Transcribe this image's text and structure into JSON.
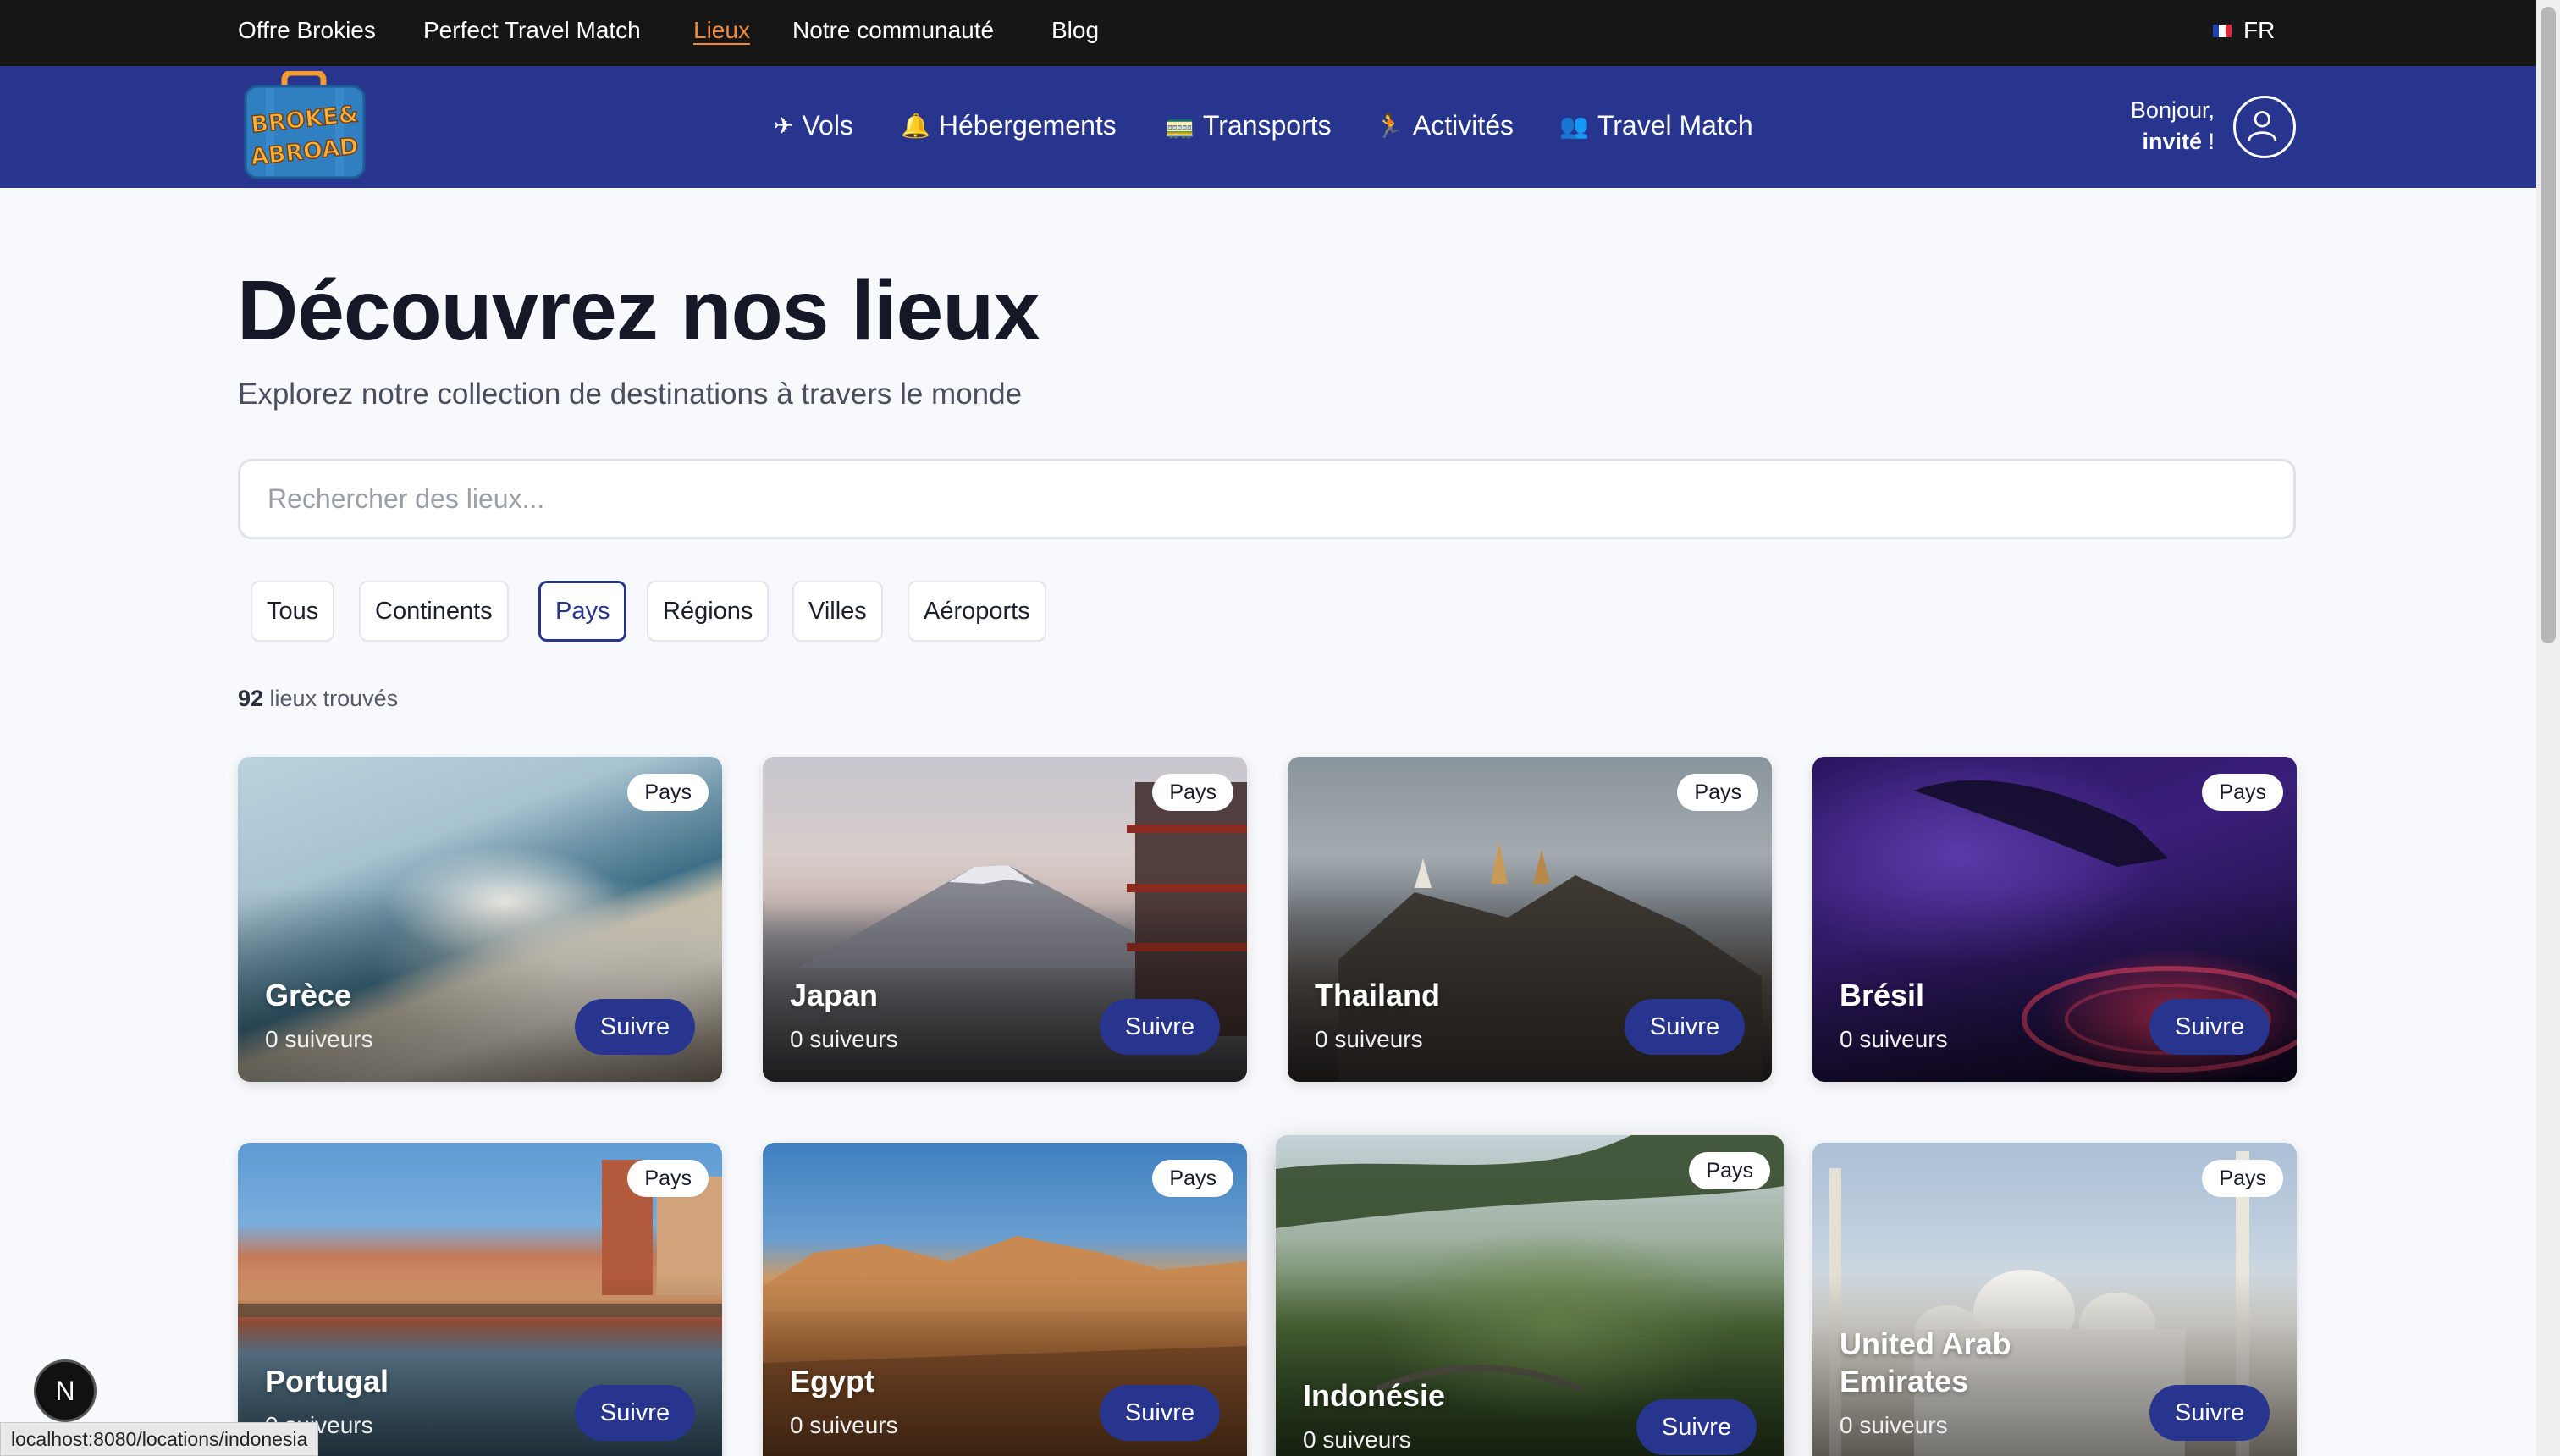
{
  "topbar": {
    "links": [
      {
        "label": "Offre Brokies",
        "active": false
      },
      {
        "label": "Perfect Travel Match",
        "active": false
      },
      {
        "label": "Lieux",
        "active": true
      },
      {
        "label": "Notre communauté",
        "active": false
      },
      {
        "label": "Blog",
        "active": false
      }
    ],
    "language": "FR"
  },
  "nav": {
    "logo_text": [
      "BROKE&",
      "ABROAD"
    ],
    "items": [
      {
        "label": "Vols",
        "icon": "airplane-icon"
      },
      {
        "label": "Hébergements",
        "icon": "bell-icon"
      },
      {
        "label": "Transports",
        "icon": "train-icon"
      },
      {
        "label": "Activités",
        "icon": "runner-icon"
      },
      {
        "label": "Travel Match",
        "icon": "people-icon"
      }
    ],
    "greeting_line1": "Bonjour,",
    "greeting_user": "invité",
    "greeting_suffix": " !"
  },
  "main": {
    "title": "Découvrez nos lieux",
    "subtitle": "Explorez notre collection de destinations à travers le monde",
    "search_placeholder": "Rechercher des lieux...",
    "filters": [
      {
        "label": "Tous",
        "active": false
      },
      {
        "label": "Continents",
        "active": false
      },
      {
        "label": "Pays",
        "active": true
      },
      {
        "label": "Régions",
        "active": false
      },
      {
        "label": "Villes",
        "active": false
      },
      {
        "label": "Aéroports",
        "active": false
      }
    ],
    "count_number": "92",
    "count_label": " lieux trouvés"
  },
  "cards": [
    {
      "name": "Grèce",
      "badge": "Pays",
      "followers": "0 suiveurs",
      "button": "Suivre"
    },
    {
      "name": "Japan",
      "badge": "Pays",
      "followers": "0 suiveurs",
      "button": "Suivre"
    },
    {
      "name": "Thailand",
      "badge": "Pays",
      "followers": "0 suiveurs",
      "button": "Suivre"
    },
    {
      "name": "Brésil",
      "badge": "Pays",
      "followers": "0 suiveurs",
      "button": "Suivre"
    },
    {
      "name": "Portugal",
      "badge": "Pays",
      "followers": "0 suiveurs",
      "button": "Suivre"
    },
    {
      "name": "Egypt",
      "badge": "Pays",
      "followers": "0 suiveurs",
      "button": "Suivre"
    },
    {
      "name": "Indonésie",
      "badge": "Pays",
      "followers": "0 suiveurs",
      "button": "Suivre"
    },
    {
      "name": "United Arab Emirates",
      "badge": "Pays",
      "followers": "0 suiveurs",
      "button": "Suivre"
    }
  ],
  "overlay": {
    "next_button_label": "N",
    "status_url": "localhost:8080/locations/indonesia"
  },
  "colors": {
    "primary": "#27358f",
    "topbar": "#161616",
    "active_link": "#f08a3c"
  }
}
